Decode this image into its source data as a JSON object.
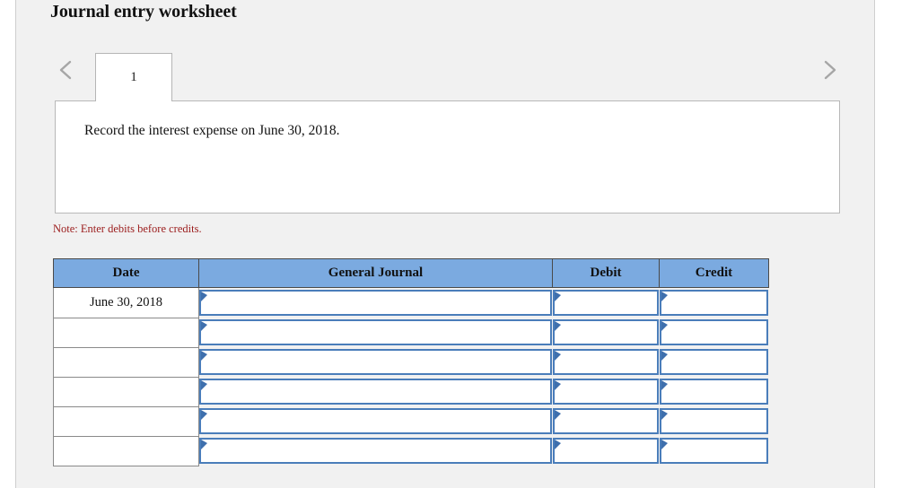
{
  "worksheet": {
    "title": "Journal entry worksheet",
    "note": "Note: Enter debits before credits."
  },
  "pager": {
    "prev_icon": "chevron-left-icon",
    "next_icon": "chevron-right-icon",
    "tabs": [
      {
        "label": "1",
        "active": true
      }
    ]
  },
  "instruction": {
    "text": "Record the interest expense on June 30, 2018."
  },
  "table": {
    "headers": {
      "date": "Date",
      "general_journal": "General Journal",
      "debit": "Debit",
      "credit": "Credit"
    },
    "rows": [
      {
        "date": "June 30, 2018",
        "general_journal": "",
        "debit": "",
        "credit": ""
      },
      {
        "date": "",
        "general_journal": "",
        "debit": "",
        "credit": ""
      },
      {
        "date": "",
        "general_journal": "",
        "debit": "",
        "credit": ""
      },
      {
        "date": "",
        "general_journal": "",
        "debit": "",
        "credit": ""
      },
      {
        "date": "",
        "general_journal": "",
        "debit": "",
        "credit": ""
      },
      {
        "date": "",
        "general_journal": "",
        "debit": "",
        "credit": ""
      }
    ]
  },
  "colors": {
    "header_blue": "#7baae0",
    "input_border_blue": "#4a7dba",
    "note_red": "#9b1c1c",
    "panel_gray": "#f1f1f1"
  }
}
